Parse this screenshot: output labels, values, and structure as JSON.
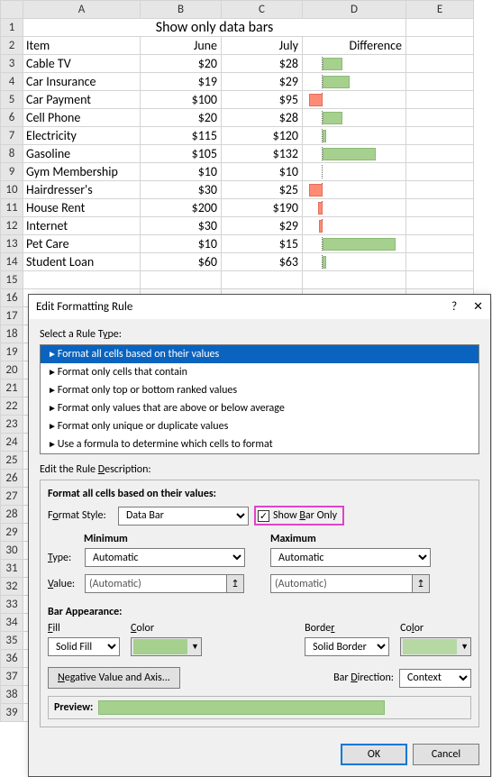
{
  "sheet": {
    "title": "Show only data bars",
    "columns": [
      "A",
      "B",
      "C",
      "D",
      "E"
    ],
    "header": {
      "item": "Item",
      "june": "June",
      "july": "July",
      "diff": "Difference"
    },
    "rows": [
      {
        "n": 3,
        "item": "Cable TV",
        "june": "$20",
        "july": "$28",
        "bar": "b20 pos"
      },
      {
        "n": 4,
        "item": "Car Insurance",
        "june": "$19",
        "july": "$29",
        "bar": "b25 pos"
      },
      {
        "n": 5,
        "item": "Car Payment",
        "june": "$100",
        "july": "$95",
        "bar": "bn15 neg"
      },
      {
        "n": 6,
        "item": "Cell Phone",
        "june": "$20",
        "july": "$28",
        "bar": "b20 pos"
      },
      {
        "n": 7,
        "item": "Electricity",
        "june": "$115",
        "july": "$120",
        "bar": "b8 pos"
      },
      {
        "n": 8,
        "item": "Gasoline",
        "june": "$105",
        "july": "$132",
        "bar": "b40 pos"
      },
      {
        "n": 9,
        "item": "Gym Membership",
        "june": "$10",
        "july": "$10",
        "bar": "none"
      },
      {
        "n": 10,
        "item": "Hairdresser's",
        "june": "$30",
        "july": "$25",
        "bar": "bn15 neg"
      },
      {
        "n": 11,
        "item": "House Rent",
        "june": "$200",
        "july": "$190",
        "bar": "bn30 neg"
      },
      {
        "n": 12,
        "item": "Internet",
        "june": "$30",
        "july": "$29",
        "bar": "bn4 neg"
      },
      {
        "n": 13,
        "item": "Pet Care",
        "june": "$10",
        "july": "$15",
        "bar": "b76 pos"
      },
      {
        "n": 14,
        "item": "Student Loan",
        "june": "$60",
        "july": "$63",
        "bar": "b8 pos"
      }
    ],
    "blank_rows_start": 15,
    "blank_rows_end": 39
  },
  "dialog": {
    "title": "Edit Formatting Rule",
    "help": "?",
    "close": "✕",
    "select_rule": "Select a Rule Type:",
    "rule_types": [
      "Format all cells based on their values",
      "Format only cells that contain",
      "Format only top or bottom ranked values",
      "Format only values that are above or below average",
      "Format only unique or duplicate values",
      "Use a formula to determine which cells to format"
    ],
    "edit_desc": "Edit the Rule Description:",
    "format_subtitle": "Format all cells based on their values:",
    "format_style_label": "Format Style:",
    "format_style_value": "Data Bar",
    "show_bar_only": "Show Bar Only",
    "min_label": "Minimum",
    "max_label": "Maximum",
    "type_label": "Type:",
    "value_label": "Value:",
    "type_value": "Automatic",
    "value_value": "(Automatic)",
    "bar_appearance": "Bar Appearance:",
    "fill_label": "Fill",
    "color_label": "Color",
    "border_label": "Border",
    "fill_value": "Solid Fill",
    "border_value": "Solid Border",
    "neg_axis": "Negative Value and Axis...",
    "bar_direction_label": "Bar Direction:",
    "bar_direction_value": "Context",
    "preview_label": "Preview:",
    "ok": "OK",
    "cancel": "Cancel"
  }
}
